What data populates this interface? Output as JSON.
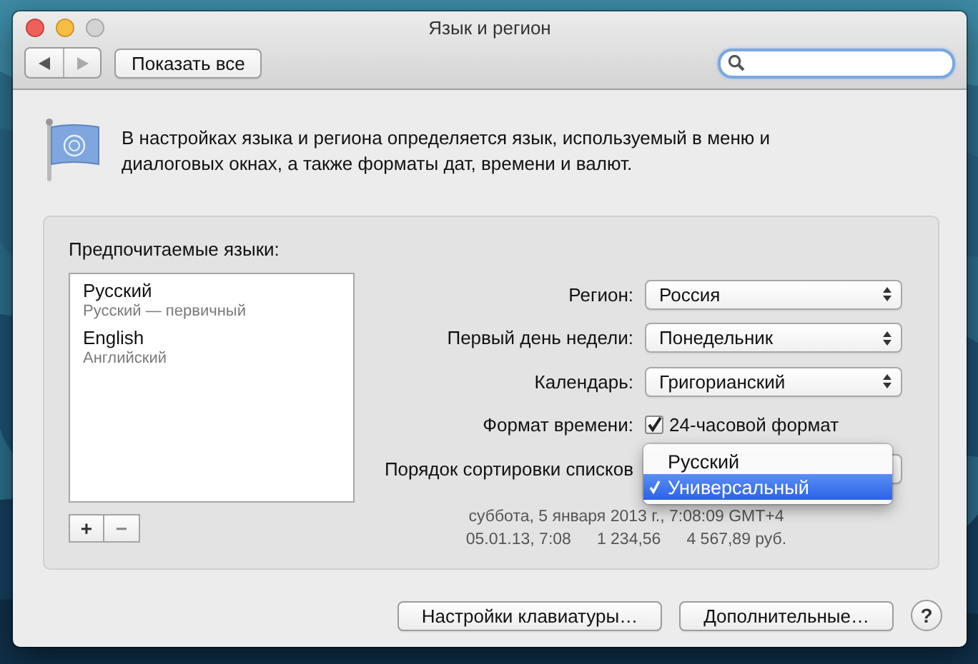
{
  "window": {
    "title": "Язык и регион"
  },
  "toolbar": {
    "show_all_button": "Показать все"
  },
  "description": "В настройках языка и региона определяется язык, используемый в меню и диалоговых окнах, а также форматы дат, времени и валют.",
  "preferred_languages": {
    "label": "Предпочитаемые языки:",
    "items": [
      {
        "name": "Русский",
        "detail": "Русский — первичный",
        "selected": false
      },
      {
        "name": "English",
        "detail": "Английский",
        "selected": false
      }
    ],
    "add_button": "+",
    "remove_button": "−"
  },
  "settings": [
    {
      "kind": "popup",
      "label": "Регион:",
      "value": "Россия"
    },
    {
      "kind": "popup",
      "label": "Первый день недели:",
      "value": "Понедельник"
    },
    {
      "kind": "popup",
      "label": "Календарь:",
      "value": "Григорианский"
    },
    {
      "kind": "checkbox",
      "label": "Формат времени:",
      "option": "24-часовой формат",
      "checked": true
    },
    {
      "kind": "popup",
      "label": "Порядок сортировки списков",
      "open": true
    }
  ],
  "sort_menu": {
    "items": [
      {
        "label": "Русский",
        "selected": false
      },
      {
        "label": "Универсальный",
        "selected": true
      }
    ]
  },
  "samples": {
    "date_line": "суббота, 5 января 2013 г., 7:08:09 GMT+4",
    "short_date": "05.01.13, 7:08",
    "number": "1 234,56",
    "currency": "4 567,89 руб."
  },
  "buttons": [
    "Настройки клавиатуры…",
    "Дополнительные…"
  ],
  "help_button": "?"
}
